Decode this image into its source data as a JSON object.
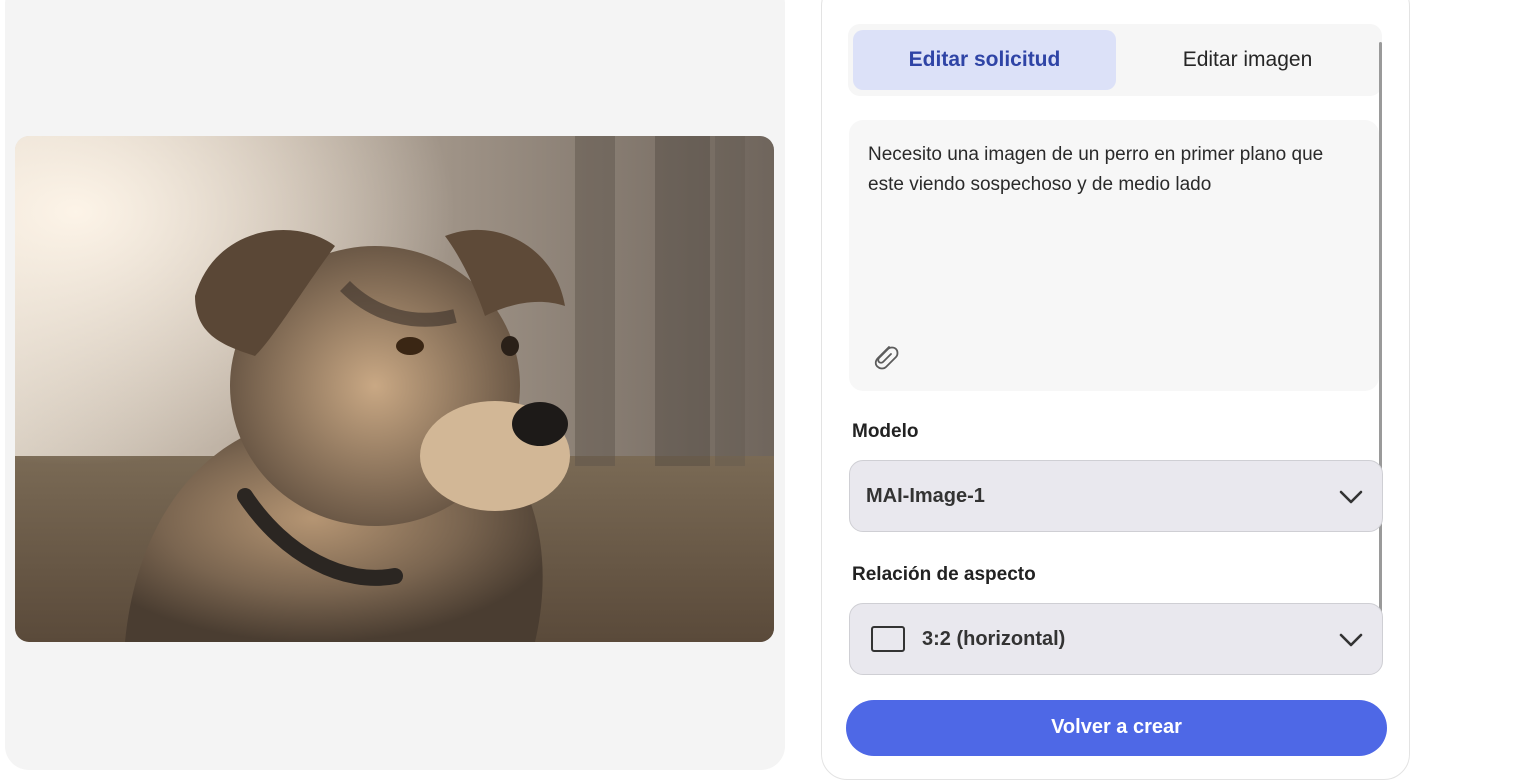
{
  "image": {
    "alt": "dog"
  },
  "tabs": [
    {
      "label": "Editar solicitud",
      "active": true
    },
    {
      "label": "Editar imagen",
      "active": false
    }
  ],
  "prompt": {
    "text": "Necesito una imagen de un perro en primer plano que este viendo sospechoso y de medio lado",
    "attach_icon": "paperclip-icon"
  },
  "model": {
    "label": "Modelo",
    "selected": "MAI-Image-1",
    "icon": "chevron-down-icon"
  },
  "aspect": {
    "label": "Relación de aspecto",
    "selected": "3:2 (horizontal)",
    "icon": "rectangle-landscape-icon"
  },
  "actions": {
    "create_label": "Volver a crear"
  },
  "colors": {
    "accent": "#4e68e6",
    "active_tab_bg": "#dce1f8",
    "active_tab_text": "#2f44a6"
  }
}
